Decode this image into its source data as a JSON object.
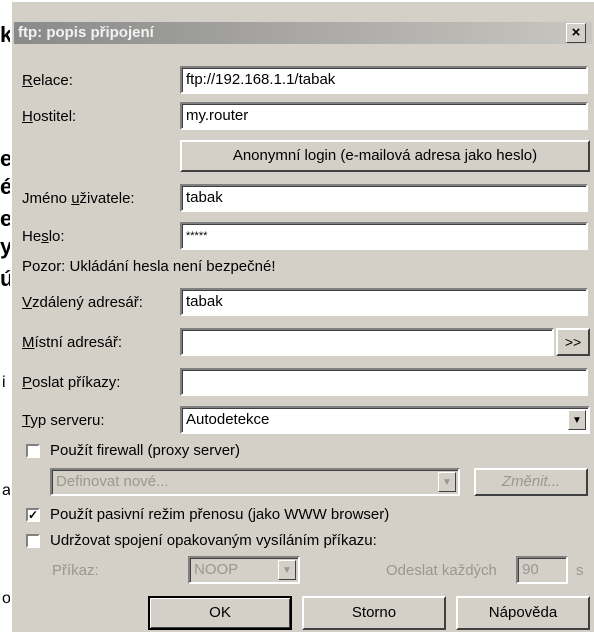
{
  "background": {
    "chars": [
      "k",
      "e",
      "é",
      "e",
      "y",
      "ú"
    ],
    "small_chars": [
      "i",
      "a",
      "o"
    ]
  },
  "dialog": {
    "title": "ftp: popis připojení",
    "close_label": "×"
  },
  "fields": {
    "relace": {
      "label_u": "R",
      "label_rest": "elace:",
      "value": "ftp://192.168.1.1/tabak"
    },
    "hostitel": {
      "label_u": "H",
      "label_rest": "ostitel:",
      "value": "my.router"
    },
    "anon_button": "Anonymní login (e-mailová adresa jako heslo)",
    "jmeno": {
      "label_pre": "Jméno ",
      "label_u": "u",
      "label_rest": "živatele:",
      "value": "tabak"
    },
    "heslo": {
      "label_pre": "He",
      "label_u": "s",
      "label_rest": "lo:",
      "value": "*****"
    },
    "warning": "Pozor: Ukládání hesla není bezpečné!",
    "vzdaleny": {
      "label_u": "V",
      "label_rest": "zdálený adresář:",
      "value": "tabak"
    },
    "mistni": {
      "label_u": "M",
      "label_rest": "ístní adresář:",
      "value": "",
      "browse": ">>"
    },
    "poslat": {
      "label_u": "P",
      "label_rest": "oslat příkazy:",
      "value": ""
    },
    "typ": {
      "label_u": "T",
      "label_rest": "yp serveru:",
      "value": "Autodetekce"
    }
  },
  "firewall": {
    "checkbox_label": "Použít firewall (proxy server)",
    "checked": false,
    "select_value": "Definovat nové...",
    "change_button": "Změnit..."
  },
  "passive": {
    "checkbox_label": "Použít pasivní režim přenosu (jako WWW browser)",
    "checked": true
  },
  "keepalive": {
    "checkbox_label": "Udržovat spojení opakovaným vysíláním příkazu:",
    "checked": false,
    "prikaz_label": "Příkaz:",
    "prikaz_value": "NOOP",
    "interval_label": "Odeslat každých",
    "interval_value": "90",
    "unit": "s"
  },
  "buttons": {
    "ok": "OK",
    "storno": "Storno",
    "help": "Nápověda"
  }
}
